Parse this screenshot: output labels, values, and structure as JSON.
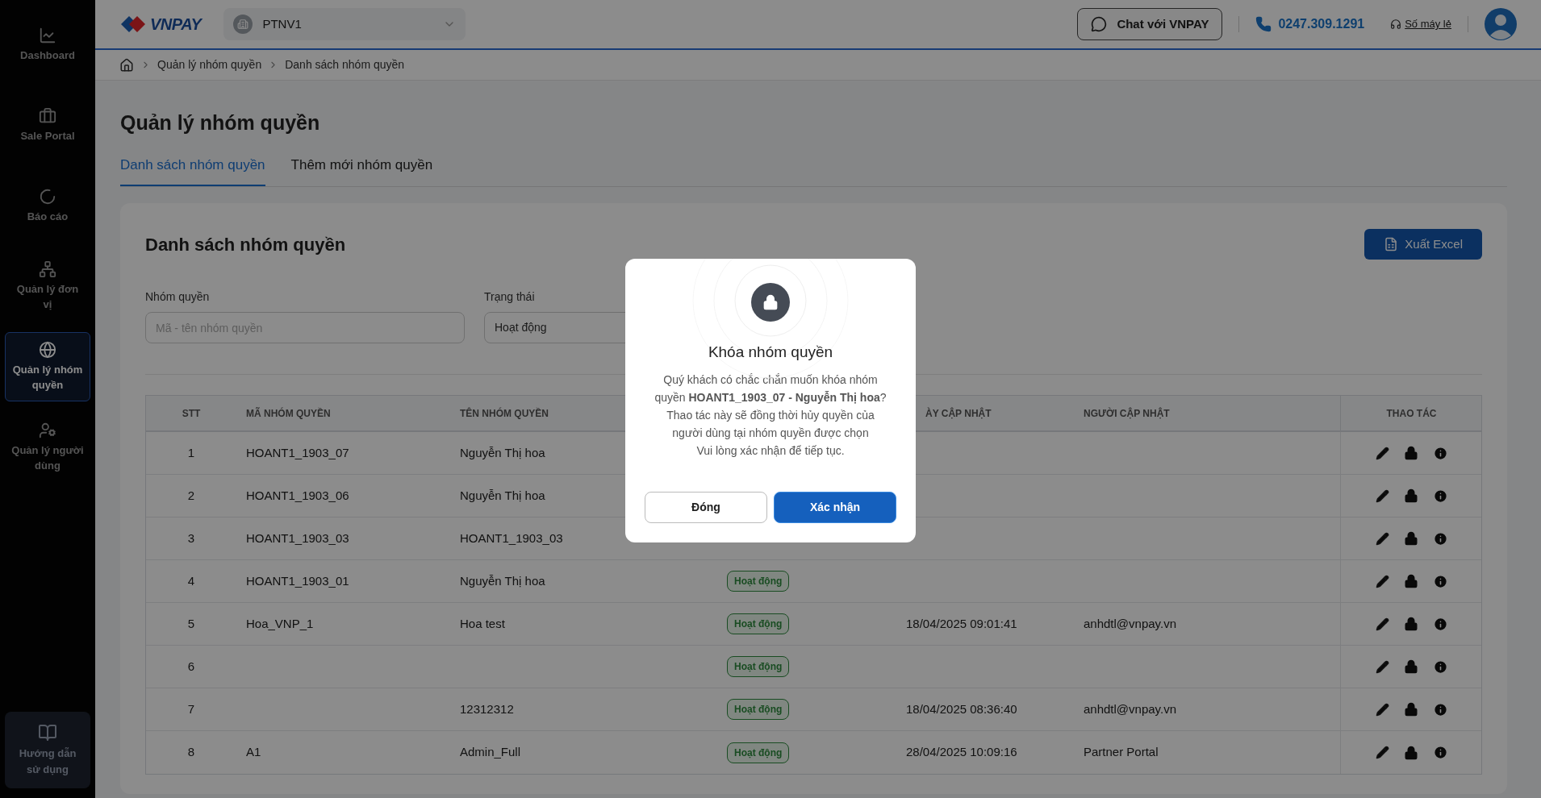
{
  "sidebar": {
    "items": [
      {
        "label": "Dashboard",
        "selected": false
      },
      {
        "label": "Sale Portal",
        "selected": false
      },
      {
        "label": "Báo cáo",
        "selected": false
      },
      {
        "label": "Quản lý đơn vị",
        "selected": false
      },
      {
        "label": "Quản lý nhóm quyền",
        "selected": true
      },
      {
        "label": "Quản lý người dùng",
        "selected": false
      }
    ],
    "guide": "Hướng dẫn sử dụng"
  },
  "header": {
    "logo": "VNPAY",
    "org_select": "PTNV1",
    "chat_button": "Chat với VNPAY",
    "phone": "0247.309.1291",
    "extension_link": "Số máy lẻ"
  },
  "breadcrumb": [
    "Quản lý nhóm quyền",
    "Danh sách nhóm quyền"
  ],
  "page_title": "Quản lý nhóm quyền",
  "tabs": [
    {
      "label": "Danh sách nhóm quyền",
      "selected": true
    },
    {
      "label": "Thêm mới nhóm quyền",
      "selected": false
    }
  ],
  "card": {
    "title": "Danh sách nhóm quyền",
    "export_button": "Xuất Excel",
    "filters": [
      {
        "label": "Nhóm quyền",
        "placeholder": "Mã - tên nhóm quyền"
      },
      {
        "label": "Trạng thái",
        "value": "Hoạt động"
      }
    ],
    "table": {
      "columns": [
        "STT",
        "MÃ NHÓM QUYỀN",
        "TÊN NHÓM QUYỀN",
        "ÀY CẬP NHẬT",
        "NGƯỜI CẬP NHẬT",
        "THAO TÁC"
      ],
      "rows": [
        {
          "stt": "1",
          "code": "HOANT1_1903_07",
          "name": "Nguyễn Thị hoa"
        },
        {
          "stt": "2",
          "code": "HOANT1_1903_06",
          "name": "Nguyễn Thị hoa"
        },
        {
          "stt": "3",
          "code": "HOANT1_1903_03",
          "name": "HOANT1_1903_03"
        },
        {
          "stt": "4",
          "code": "HOANT1_1903_01",
          "name": "Nguyễn Thị hoa",
          "status": "Hoạt động"
        },
        {
          "stt": "5",
          "code": "Hoa_VNP_1",
          "name": "Hoa test",
          "status": "Hoạt động",
          "updated_at": "18/04/2025 09:01:41",
          "updated_by": "anhdtl@vnpay.vn"
        },
        {
          "stt": "6",
          "status": "Hoạt động"
        },
        {
          "stt": "7",
          "name": "12312312",
          "status": "Hoạt động",
          "updated_at": "18/04/2025 08:36:40",
          "updated_by": "anhdtl@vnpay.vn"
        },
        {
          "stt": "8",
          "code": "A1",
          "name": "Admin_Full",
          "status": "Hoạt động",
          "updated_at": "28/04/2025 10:09:16",
          "updated_by": "Partner Portal"
        }
      ]
    }
  },
  "dialog": {
    "title": "Khóa nhóm quyền",
    "paragraphs": [
      "Quý khách có chắc chắn muốn khóa nhóm quyền **HOANT1_1903_07 - Nguyễn Thị hoa**?",
      "Thao tác này sẽ đồng thời hủy quyền của người dùng tại nhóm quyền được chọn",
      "Vui lòng xác nhận để tiếp tục."
    ],
    "buttons": [
      "Đóng",
      "Xác nhận"
    ]
  }
}
